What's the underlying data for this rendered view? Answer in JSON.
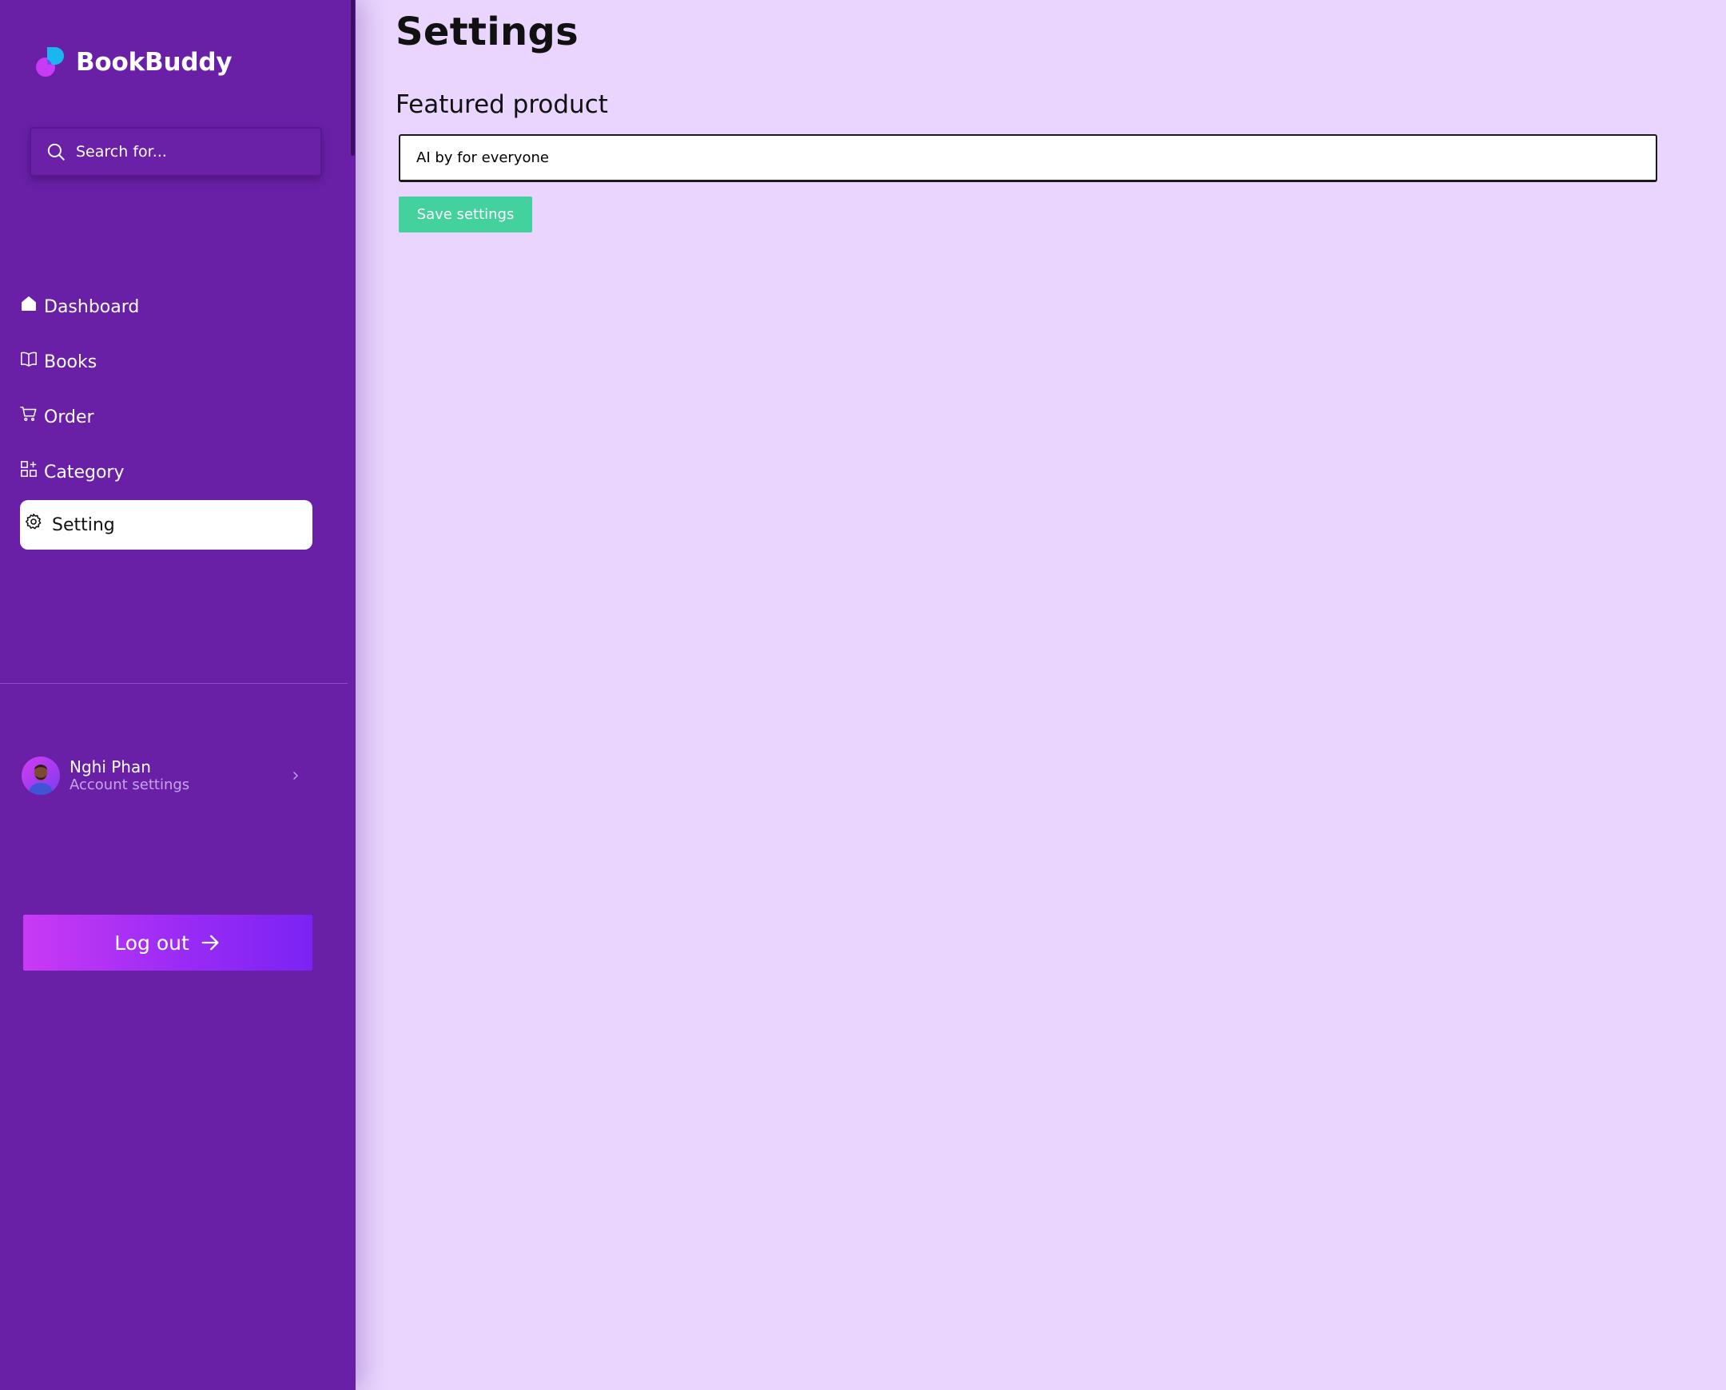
{
  "app": {
    "name": "BookBuddy"
  },
  "search": {
    "placeholder": "Search for..."
  },
  "sidebar": {
    "items": [
      {
        "label": "Dashboard",
        "icon": "home-icon"
      },
      {
        "label": "Books",
        "icon": "book-icon"
      },
      {
        "label": "Order",
        "icon": "cart-icon"
      },
      {
        "label": "Category",
        "icon": "grid-icon"
      },
      {
        "label": "Setting",
        "icon": "gear-icon",
        "active": true
      }
    ]
  },
  "user": {
    "name": "Nghi Phan",
    "subtitle": "Account settings"
  },
  "logout": {
    "label": "Log out"
  },
  "page": {
    "title": "Settings",
    "field_label": "Featured product",
    "field_value": "AI by for everyone",
    "save_label": "Save settings"
  },
  "colors": {
    "sidebar_bg": "#6920a7",
    "page_bg": "#e9d5fd",
    "save_button": "#43d19e",
    "logout_gradient_start": "#c93af4",
    "logout_gradient_end": "#7b23f4"
  }
}
